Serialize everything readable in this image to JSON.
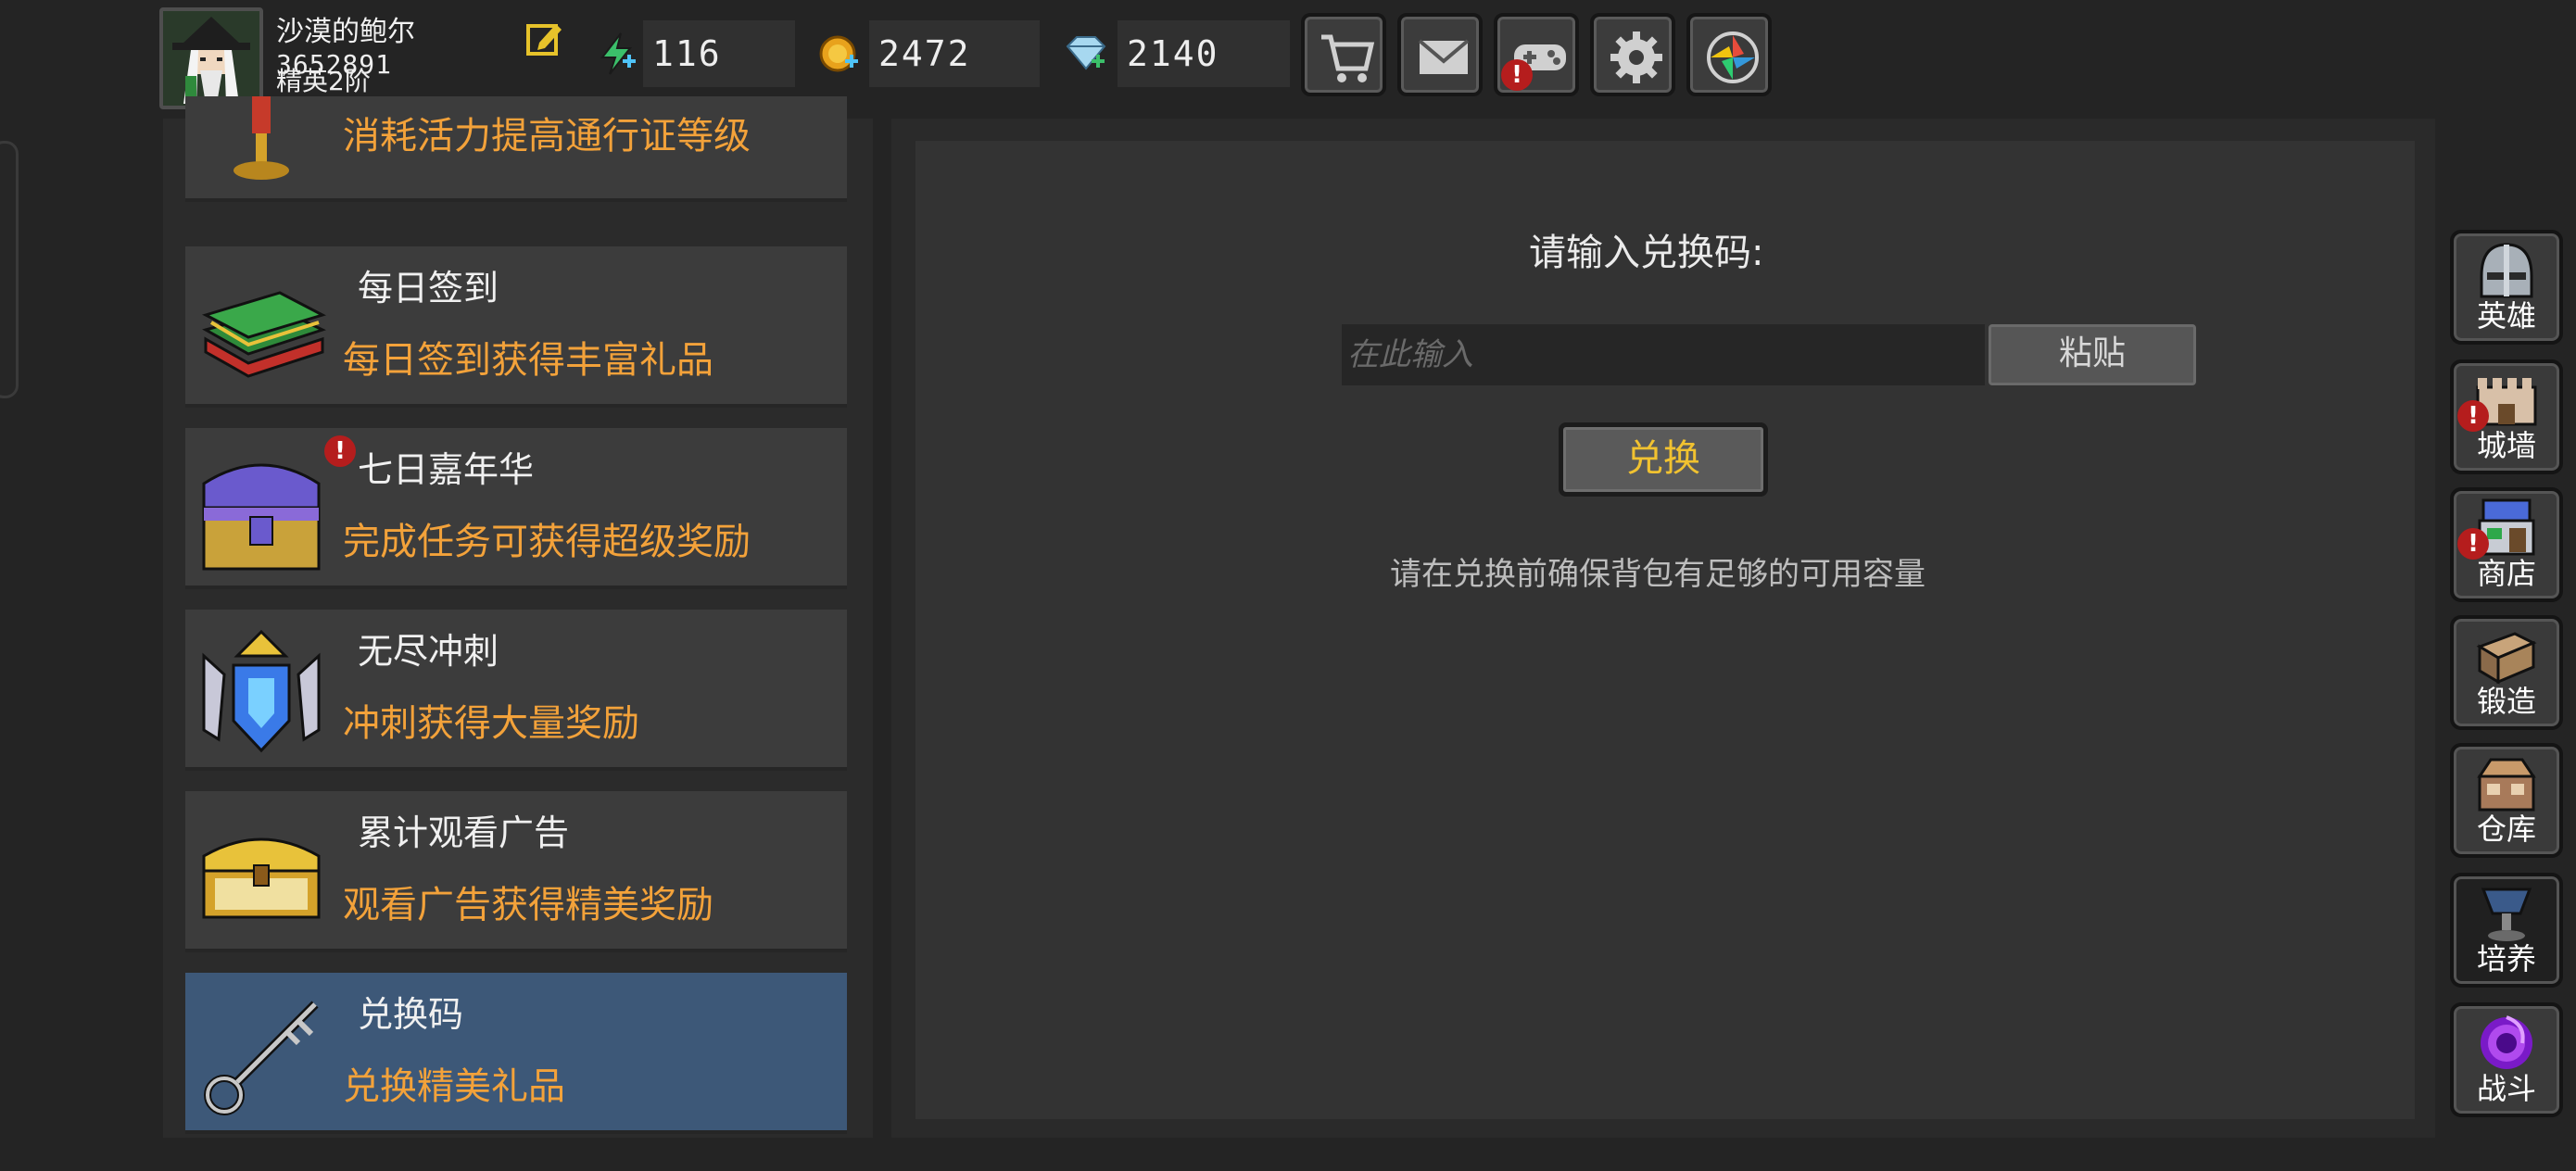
{
  "player": {
    "name": "沙漠的鲍尔",
    "id": "3652891",
    "rank": "精英2阶"
  },
  "resources": {
    "energy": "116",
    "gold": "2472",
    "diamond": "2140"
  },
  "menu": [
    {
      "title": "",
      "desc": "消耗活力提高通行证等级",
      "icon": "trophy-icon"
    },
    {
      "title": "每日签到",
      "desc": "每日签到获得丰富礼品",
      "icon": "book-stack-icon"
    },
    {
      "title": "七日嘉年华",
      "desc": "完成任务可获得超级奖励",
      "icon": "purple-chest-icon",
      "alert": "!"
    },
    {
      "title": "无尽冲刺",
      "desc": "冲刺获得大量奖励",
      "icon": "crystal-crest-icon"
    },
    {
      "title": "累计观看广告",
      "desc": "观看广告获得精美奖励",
      "icon": "gold-chest-icon"
    },
    {
      "title": "兑换码",
      "desc": "兑换精美礼品",
      "icon": "key-icon"
    }
  ],
  "redeem": {
    "title": "请输入兑换码:",
    "placeholder": "在此输入",
    "paste_label": "粘贴",
    "redeem_label": "兑换",
    "note": "请在兑换前确保背包有足够的可用容量"
  },
  "sidebar": [
    {
      "label": "英雄",
      "icon": "helmet-icon"
    },
    {
      "label": "城墙",
      "icon": "wall-icon",
      "alert": "!"
    },
    {
      "label": "商店",
      "icon": "shop-icon",
      "alert": "!"
    },
    {
      "label": "锻造",
      "icon": "anvil-icon"
    },
    {
      "label": "仓库",
      "icon": "warehouse-icon"
    },
    {
      "label": "培养",
      "icon": "chalice-icon"
    },
    {
      "label": "战斗",
      "icon": "portal-icon"
    }
  ],
  "colors": {
    "accent_orange": "#f3a23a",
    "accent_gold": "#f1c230",
    "active_item": "#3d5878",
    "alert_red": "#b51d1d"
  }
}
